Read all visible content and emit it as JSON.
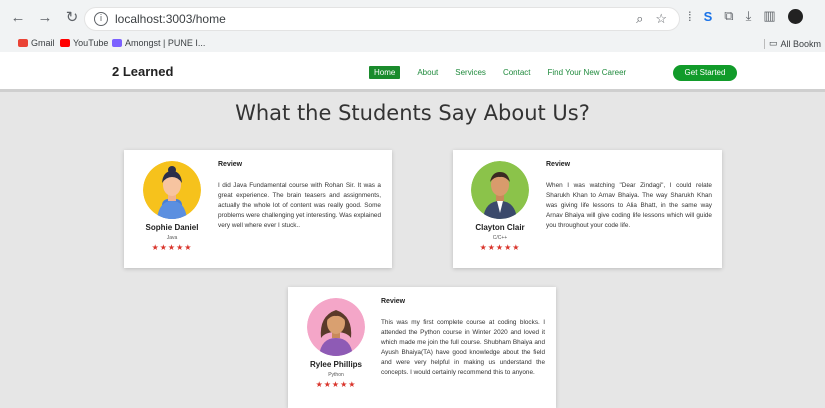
{
  "browser": {
    "url": "localhost:3003/home",
    "bookmarks": [
      {
        "label": "Gmail",
        "color": "#ea4335"
      },
      {
        "label": "YouTube",
        "color": "#ff0000"
      },
      {
        "label": "Amongst | PUNE I...",
        "color": "#7b61ff"
      }
    ],
    "all_bookmarks": "All Bookm"
  },
  "site": {
    "logo": "2 Learned",
    "nav": [
      "Home",
      "About",
      "Services",
      "Contact",
      "Find Your New Career"
    ],
    "cta": "Get Started"
  },
  "page": {
    "title": "What the Students Say About Us?"
  },
  "reviews": [
    {
      "name": "Sophie Daniel",
      "course": "Java",
      "stars": "★★★★★",
      "label": "Review",
      "text": "I did Java Fundamental course with Rohan Sir. It was a great experience. The brain teasers and assignments, actually the whole lot of content was really good. Some problems were challenging yet interesting. Was explained very well where ever I stuck..",
      "avatar_bg": "#f6c21c"
    },
    {
      "name": "Clayton Clair",
      "course": "C/C++",
      "stars": "★★★★★",
      "label": "Review",
      "text": "When I was watching \"Dear Zindagi\", I could relate Sharukh Khan to Arnav Bhaiya. The way Sharukh Khan was giving life lessons to Alia Bhatt, in the same way Arnav Bhaiya will give coding life lessons which will guide you throughout your code life.",
      "avatar_bg": "#8bc34a"
    },
    {
      "name": "Rylee Phillips",
      "course": "Python",
      "stars": "★★★★★",
      "label": "Review",
      "text": "This was my first complete course at coding blocks. I attended the Python course in Winter 2020 and loved it which made me join the full course. Shubham Bhaiya and Ayush Bhaiya(TA) have good knowledge about the field and were very helpful in making us understand the concepts. I would certainly recommend this to anyone.",
      "avatar_bg": "#f4a6c8"
    }
  ]
}
